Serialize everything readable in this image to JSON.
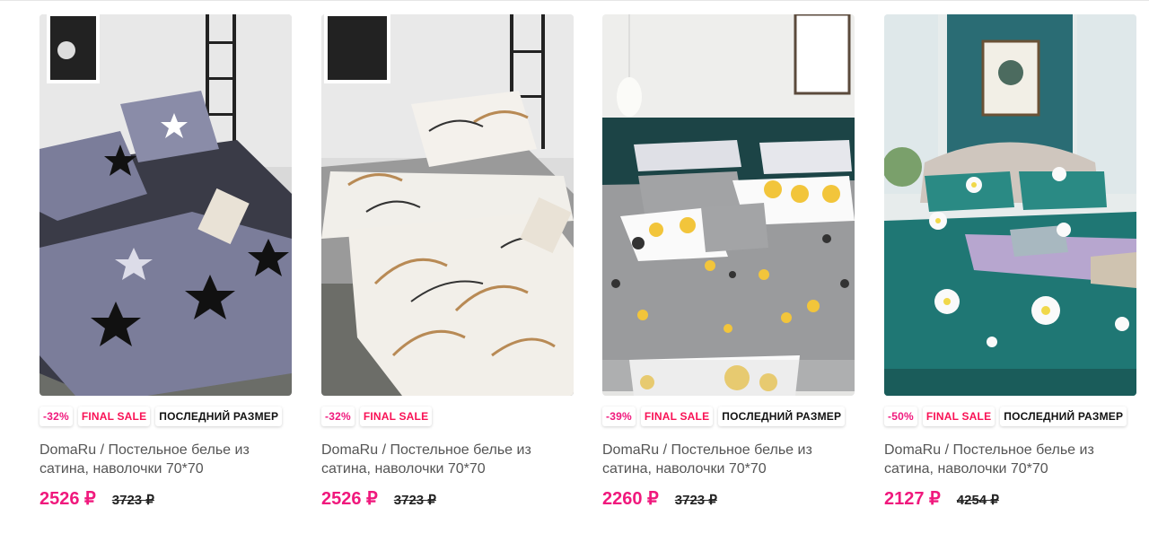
{
  "products": [
    {
      "badges": [
        "-32%",
        "FINAL SALE",
        "ПОСЛЕДНИЙ РАЗМЕР"
      ],
      "title": "DomaRu / Постельное белье из сатина, наволочки 70*70",
      "price": "2526 ₽",
      "old_price": "3723 ₽",
      "image": "bedding-grey-stars"
    },
    {
      "badges": [
        "-32%",
        "FINAL SALE"
      ],
      "title": "DomaRu / Постельное белье из сатина, наволочки 70*70",
      "price": "2526 ₽",
      "old_price": "3723 ₽",
      "image": "bedding-palm-leaves"
    },
    {
      "badges": [
        "-39%",
        "FINAL SALE",
        "ПОСЛЕДНИЙ РАЗМЕР"
      ],
      "title": "DomaRu / Постельное белье из сатина, наволочки 70*70",
      "price": "2260 ₽",
      "old_price": "3723 ₽",
      "image": "bedding-grey-yellow-dots"
    },
    {
      "badges": [
        "-50%",
        "FINAL SALE",
        "ПОСЛЕДНИЙ РАЗМЕР"
      ],
      "title": "DomaRu / Постельное белье из сатина, наволочки 70*70",
      "price": "2127 ₽",
      "old_price": "4254 ₽",
      "image": "bedding-teal-flowers"
    }
  ],
  "colors": {
    "accent": "#f0197d",
    "final_sale": "#f91155"
  }
}
